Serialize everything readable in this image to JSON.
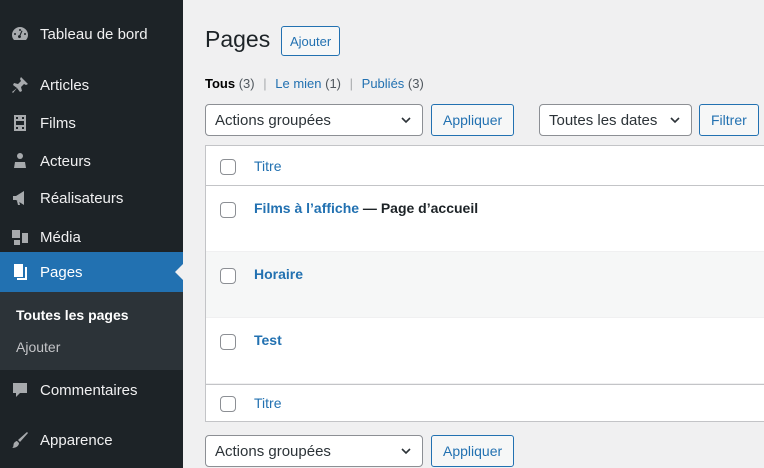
{
  "sidebar": {
    "items": [
      {
        "label": "Tableau de bord",
        "icon": "dashboard-icon"
      },
      {
        "label": "Articles",
        "icon": "pin-icon"
      },
      {
        "label": "Films",
        "icon": "film-icon"
      },
      {
        "label": "Acteurs",
        "icon": "users-icon"
      },
      {
        "label": "Réalisateurs",
        "icon": "megaphone-icon"
      },
      {
        "label": "Média",
        "icon": "media-icon"
      },
      {
        "label": "Pages",
        "icon": "pages-icon"
      },
      {
        "label": "Commentaires",
        "icon": "comment-icon"
      },
      {
        "label": "Apparence",
        "icon": "brush-icon"
      }
    ],
    "submenu": {
      "current": "Toutes les pages",
      "other": "Ajouter"
    }
  },
  "header": {
    "title": "Pages",
    "add_label": "Ajouter"
  },
  "filters": {
    "all": {
      "label": "Tous",
      "count": "(3)"
    },
    "mine": {
      "label": "Le mien",
      "count": "(1)"
    },
    "published": {
      "label": "Publiés",
      "count": "(3)"
    },
    "separator": "|"
  },
  "bulk_top": {
    "select_value": "Actions groupées",
    "apply_label": "Appliquer"
  },
  "date_filter": {
    "select_value": "Toutes les dates",
    "filter_label": "Filtrer"
  },
  "table": {
    "column_title": "Titre",
    "rows": [
      {
        "title": "Films à l’affiche",
        "state": " — Page d’accueil"
      },
      {
        "title": "Horaire",
        "state": ""
      },
      {
        "title": "Test",
        "state": ""
      }
    ]
  },
  "bulk_bottom": {
    "select_value": "Actions groupées",
    "apply_label": "Appliquer"
  },
  "colors": {
    "sidebar_bg": "#1d2327",
    "accent": "#2271b1",
    "submenu_bg": "#2c3338"
  }
}
